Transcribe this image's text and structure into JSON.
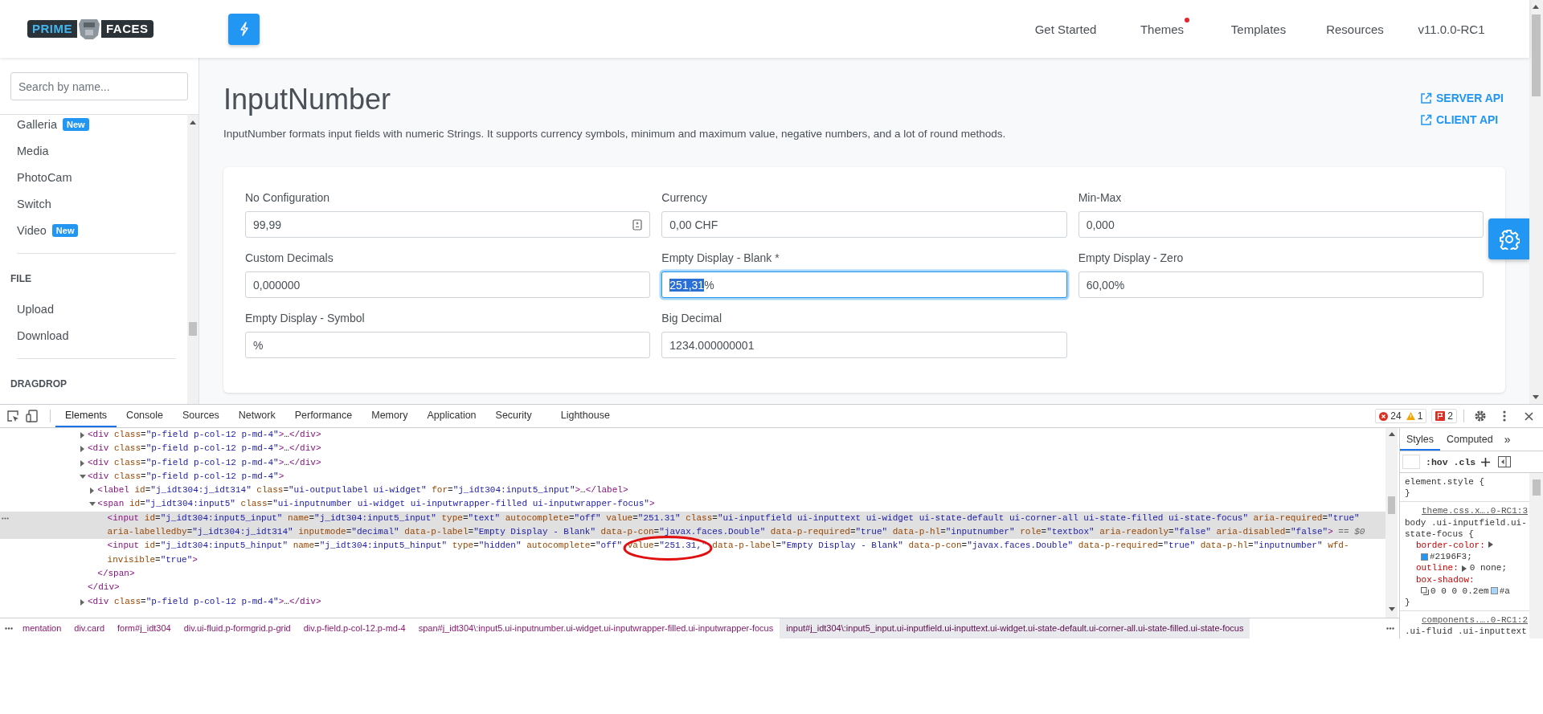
{
  "header": {
    "logo": {
      "left": "PRIME",
      "right": "FACES"
    },
    "nav": [
      {
        "label": "Get Started",
        "dot": false
      },
      {
        "label": "Themes",
        "dot": true
      },
      {
        "label": "Templates",
        "dot": false
      },
      {
        "label": "Resources",
        "dot": false
      },
      {
        "label": "v11.0.0-RC1",
        "dot": false
      }
    ]
  },
  "sidebar": {
    "search": {
      "placeholder": "Search by name..."
    },
    "sections": [
      {
        "items": [
          {
            "label": "Galleria",
            "badge": "New"
          },
          {
            "label": "Media"
          },
          {
            "label": "PhotoCam"
          },
          {
            "label": "Switch"
          },
          {
            "label": "Video",
            "badge": "New"
          }
        ]
      },
      {
        "title": "FILE",
        "items": [
          {
            "label": "Upload"
          },
          {
            "label": "Download"
          }
        ]
      },
      {
        "title": "DRAGDROP"
      }
    ]
  },
  "page": {
    "title": "InputNumber",
    "description": "InputNumber formats input fields with numeric Strings. It supports currency symbols, minimum and maximum value, negative numbers, and a lot of round methods.",
    "links": [
      "SERVER API",
      "CLIENT API"
    ],
    "fields": [
      {
        "label": "No Configuration",
        "value_parts": [
          {
            "text": "99,99",
            "highlighted": false
          }
        ],
        "focused": false,
        "icon": true
      },
      {
        "label": "Currency",
        "value_parts": [
          {
            "text": "0,00 CHF",
            "highlighted": false
          }
        ],
        "focused": false
      },
      {
        "label": "Min-Max",
        "value_parts": [
          {
            "text": "0,000",
            "highlighted": false
          }
        ],
        "focused": false
      },
      {
        "label": "Custom Decimals",
        "value_parts": [
          {
            "text": "0,000000",
            "highlighted": false
          }
        ],
        "focused": false
      },
      {
        "label": "Empty Display - Blank *",
        "value_parts": [
          {
            "text": "251,31",
            "highlighted": true
          },
          {
            "text": "%",
            "highlighted": false
          }
        ],
        "focused": true
      },
      {
        "label": "Empty Display - Zero",
        "value_parts": [
          {
            "text": "60,00%",
            "highlighted": false
          }
        ],
        "focused": false
      },
      {
        "label": "Empty Display - Symbol",
        "value_parts": [
          {
            "text": "%",
            "highlighted": false
          }
        ],
        "focused": false
      },
      {
        "label": "Big Decimal",
        "value_parts": [
          {
            "text": "1234.000000001",
            "highlighted": false
          }
        ],
        "focused": false
      }
    ]
  },
  "devtools": {
    "tabs": [
      {
        "label": "Elements",
        "selected": true
      },
      {
        "label": "Console",
        "selected": false
      },
      {
        "label": "Sources",
        "selected": false
      },
      {
        "label": "Network",
        "selected": false
      },
      {
        "label": "Performance",
        "selected": false
      },
      {
        "label": "Memory",
        "selected": false
      },
      {
        "label": "Application",
        "selected": false
      },
      {
        "label": "Security",
        "selected": false
      },
      {
        "label": "Lighthouse",
        "selected": false
      }
    ],
    "counters": {
      "errors": "24",
      "warnings": "1",
      "issues": "2"
    },
    "nodes": [
      {
        "lines": [
          "<div class=\"p-field p-col-12 p-md-4\">…</div>"
        ],
        "expanded": false,
        "selected": false
      },
      {
        "lines": [
          "<div class=\"p-field p-col-12 p-md-4\">…</div>"
        ],
        "expanded": false,
        "selected": false
      },
      {
        "lines": [
          "<div class=\"p-field p-col-12 p-md-4\">…</div>"
        ],
        "expanded": false,
        "selected": false
      },
      {
        "lines": [
          "<div class=\"p-field p-col-12 p-md-4\">"
        ],
        "expanded": true,
        "selected": false,
        "closing": "</div>",
        "children": [
          {
            "lines": [
              "<label id=\"j_idt304:j_idt314\" class=\"ui-outputlabel ui-widget\" for=\"j_idt304:input5_input\">…</label>"
            ],
            "expanded": false,
            "selected": false
          },
          {
            "lines": [
              "<span id=\"j_idt304:input5\" class=\"ui-inputnumber ui-widget ui-inputwrapper-filled ui-inputwrapper-focus\">"
            ],
            "expanded": true,
            "selected": false,
            "closing": "</span>",
            "children": [
              {
                "lines": [
                  "<input id=\"j_idt304:input5_input\" name=\"j_idt304:input5_input\" type=\"text\" autocomplete=\"off\" value=\"251.31\" class=\"ui-inputfield ui-inputtext ui-widget ui-state-default ui-corner-all ui-state-filled ui-state-focus\" aria-required=\"true\"",
                  "aria-labelledby=\"j_idt304:j_idt314\" inputmode=\"decimal\" data-p-label=\"Empty Display - Blank\" data-p-con=\"javax.faces.Double\" data-p-required=\"true\" data-p-hl=\"inputnumber\" role=\"textbox\" aria-readonly=\"false\" aria-disabled=\"false\">"
                ],
                "selected": true,
                "console_ref": "== $0"
              },
              {
                "lines": [
                  "<input id=\"j_idt304:input5_hinput\" name=\"j_idt304:input5_hinput\" type=\"hidden\" autocomplete=\"off\" value=\"251.31,\" data-p-label=\"Empty Display - Blank\" data-p-con=\"javax.faces.Double\" data-p-required=\"true\" data-p-hl=\"inputnumber\" wfd-",
                  "invisible=\"true\">"
                ],
                "selected": false
              }
            ]
          }
        ]
      },
      {
        "lines": [
          "<div class=\"p-field p-col-12 p-md-4\">…</div>"
        ],
        "expanded": false,
        "selected": false
      }
    ],
    "breadcrumbs": [
      {
        "text": "mentation",
        "selected": false
      },
      {
        "text": "div.card",
        "selected": false
      },
      {
        "text": "form#j_idt304",
        "selected": false
      },
      {
        "text": "div.ui-fluid.p-formgrid.p-grid",
        "selected": false
      },
      {
        "text": "div.p-field.p-col-12.p-md-4",
        "selected": false
      },
      {
        "text": "span#j_idt304\\:input5.ui-inputnumber.ui-widget.ui-inputwrapper-filled.ui-inputwrapper-focus",
        "selected": false
      },
      {
        "text": "input#j_idt304\\:input5_input.ui-inputfield.ui-inputtext.ui-widget.ui-state-default.ui-corner-all.ui-state-filled.ui-state-focus",
        "selected": true
      }
    ],
    "styles": {
      "tabs": [
        {
          "label": "Styles",
          "selected": true
        },
        {
          "label": "Computed",
          "selected": false
        }
      ],
      "more": "»",
      "filters": [
        ":hov",
        ".cls"
      ],
      "rules": [
        {
          "selector_lines": [
            "element.style {"
          ],
          "close": "}"
        },
        {
          "source": "theme.css.x….0-RC1:3",
          "selector_lines": [
            "body .ui-inputfield.ui-",
            "state-focus {"
          ],
          "close": "}",
          "props": [
            {
              "name": "border-color:",
              "parts": [
                {
                  "kind": "expander"
                },
                {
                  "kind": "swatch",
                  "color": "#2196f3"
                },
                {
                  "kind": "text",
                  "text": "#2196F3;"
                }
              ],
              "wrapped": true
            },
            {
              "name": "outline:",
              "parts": [
                {
                  "kind": "expander"
                },
                {
                  "kind": "text",
                  "text": "0 none;"
                }
              ],
              "wrapped": false
            },
            {
              "name": "box-shadow:",
              "parts": [
                {
                  "kind": "shadow_icon"
                },
                {
                  "kind": "text",
                  "text": "0 0 0 0.2em"
                },
                {
                  "kind": "swatch",
                  "color": "#a6d5fa"
                },
                {
                  "kind": "text",
                  "text": "#a"
                }
              ],
              "wrapped": true
            }
          ]
        },
        {
          "source": "components.….0-RC1:2",
          "selector_lines": [
            ".ui-fluid .ui-inputtext"
          ]
        }
      ]
    }
  }
}
